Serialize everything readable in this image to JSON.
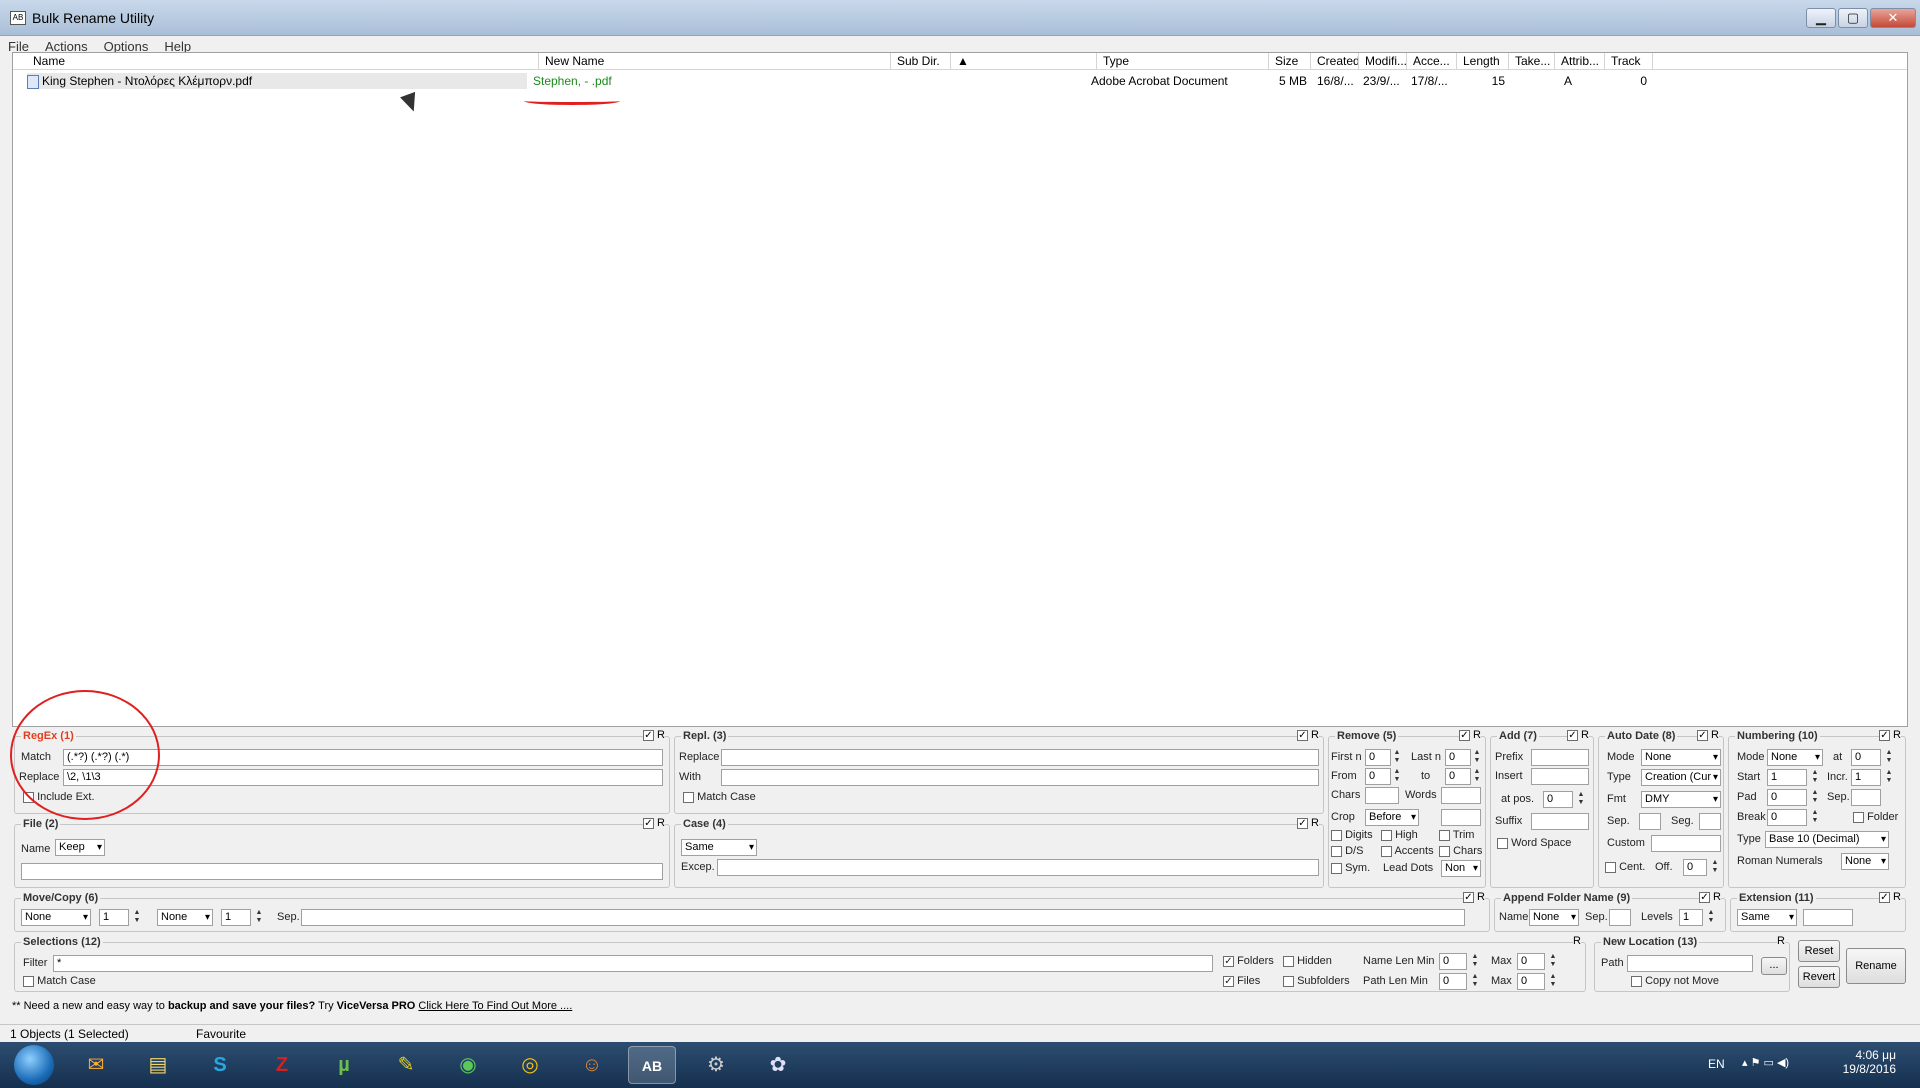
{
  "window": {
    "title": "Bulk Rename Utility",
    "min": "▁",
    "max": "▢",
    "close": "✕"
  },
  "menu": [
    "File",
    "Actions",
    "Options",
    "Help"
  ],
  "list": {
    "columns": [
      "Name",
      "New Name",
      "Sub Dir.",
      "Type",
      "Size",
      "Created",
      "Modifi...",
      "Acce...",
      "Length",
      "Take...",
      "Attrib...",
      "Track"
    ],
    "sort_indicator": "▲",
    "rows": [
      {
        "name": "King Stephen - Ντολόρες Κλέμπορν.pdf",
        "new_name": "Stephen, - .pdf",
        "sub_dir": "",
        "type": "Adobe Acrobat Document",
        "size": "5 MB",
        "created": "16/8/...",
        "modified": "23/9/...",
        "accessed": "17/8/...",
        "length": "15",
        "taken": "",
        "attrib": "A",
        "track": "0"
      }
    ]
  },
  "regex": {
    "title": "RegEx (1)",
    "match_label": "Match",
    "match_value": "(.*?) (.*?) (.*)",
    "replace_label": "Replace",
    "replace_value": "\\2, \\1\\3",
    "include_ext": "Include Ext.",
    "r": "R"
  },
  "repl": {
    "title": "Repl. (3)",
    "replace_label": "Replace",
    "with_label": "With",
    "match_case": "Match Case",
    "r": "R"
  },
  "file": {
    "title": "File (2)",
    "name_label": "Name",
    "name_value": "Keep",
    "r": "R"
  },
  "case": {
    "title": "Case (4)",
    "value": "Same",
    "excep_label": "Excep.",
    "r": "R"
  },
  "remove": {
    "title": "Remove (5)",
    "first_n": "First n",
    "first_n_val": "0",
    "last_n": "Last n",
    "last_n_val": "0",
    "from": "From",
    "from_val": "0",
    "to": "to",
    "to_val": "0",
    "chars": "Chars",
    "words": "Words",
    "crop": "Crop",
    "crop_val": "Before",
    "digits": "Digits",
    "high": "High",
    "trim": "Trim",
    "ds": "D/S",
    "accents": "Accents",
    "chars2": "Chars",
    "sym": "Sym.",
    "lead_dots": "Lead Dots",
    "lead_val": "Non",
    "r": "R"
  },
  "add": {
    "title": "Add (7)",
    "prefix": "Prefix",
    "insert": "Insert",
    "at_pos": "at pos.",
    "at_pos_val": "0",
    "suffix": "Suffix",
    "word_space": "Word Space",
    "r": "R"
  },
  "autodate": {
    "title": "Auto Date (8)",
    "mode": "Mode",
    "mode_val": "None",
    "type": "Type",
    "type_val": "Creation (Cur",
    "fmt": "Fmt",
    "fmt_val": "DMY",
    "sep": "Sep.",
    "seg": "Seg.",
    "custom": "Custom",
    "cent": "Cent.",
    "off": "Off.",
    "off_val": "0",
    "r": "R"
  },
  "numbering": {
    "title": "Numbering (10)",
    "mode": "Mode",
    "mode_val": "None",
    "at": "at",
    "at_val": "0",
    "start": "Start",
    "start_val": "1",
    "incr": "Incr.",
    "incr_val": "1",
    "pad": "Pad",
    "pad_val": "0",
    "sep": "Sep.",
    "break": "Break",
    "break_val": "0",
    "folder": "Folder",
    "type": "Type",
    "type_val": "Base 10 (Decimal)",
    "roman": "Roman Numerals",
    "roman_val": "None",
    "r": "R"
  },
  "movecopy": {
    "title": "Move/Copy (6)",
    "sel1": "None",
    "num1": "1",
    "sel2": "None",
    "num2": "1",
    "sep": "Sep.",
    "r": "R"
  },
  "appendfolder": {
    "title": "Append Folder Name (9)",
    "name": "Name",
    "name_val": "None",
    "sep": "Sep.",
    "levels": "Levels",
    "levels_val": "1",
    "r": "R"
  },
  "extension": {
    "title": "Extension (11)",
    "value": "Same",
    "r": "R"
  },
  "selections": {
    "title": "Selections (12)",
    "filter_label": "Filter",
    "filter_value": "*",
    "match_case": "Match Case",
    "folders": "Folders",
    "hidden": "Hidden",
    "files": "Files",
    "subfolders": "Subfolders",
    "name_len_min": "Name Len Min",
    "name_len_min_val": "0",
    "max1": "Max",
    "max1_val": "0",
    "path_len_min": "Path Len Min",
    "path_len_min_val": "0",
    "max2": "Max",
    "max2_val": "0",
    "r": "R"
  },
  "newlocation": {
    "title": "New Location (13)",
    "path": "Path",
    "browse": "...",
    "copy_not_move": "Copy not Move",
    "r": "R"
  },
  "buttons": {
    "reset": "Reset",
    "revert": "Revert",
    "rename": "Rename"
  },
  "promo": {
    "prefix": "** Need a new and easy way to ",
    "bold1": "backup and save your files?",
    "mid": " Try ",
    "bold2": "ViceVersa PRO",
    "link": "Click Here To Find Out More ...."
  },
  "status": {
    "objects": "1 Objects (1 Selected)",
    "favourite": "Favourite"
  },
  "taskbar": {
    "icons": [
      "outlook-icon",
      "explorer-icon",
      "skype-icon",
      "filezilla-icon",
      "utorrent-icon",
      "qbit-icon",
      "ie-icon",
      "chrome-icon",
      "monkey-icon",
      "bulk-rename-icon",
      "camera-icon",
      "paint-icon"
    ],
    "lang": "EN",
    "time": "4:06 μμ",
    "date": "19/8/2016"
  }
}
